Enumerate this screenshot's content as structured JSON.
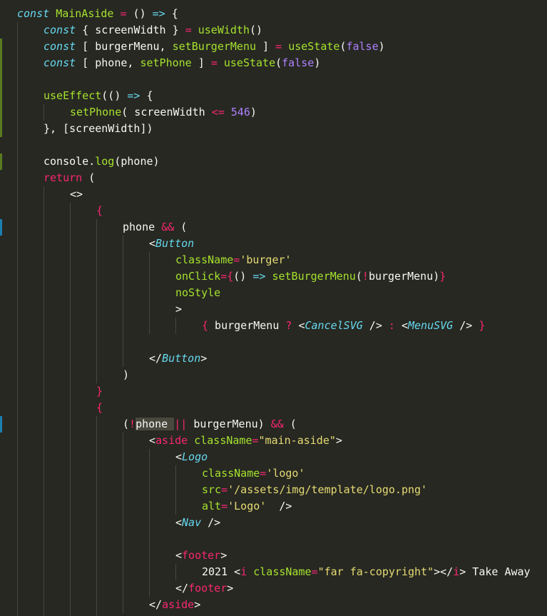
{
  "colors": {
    "background": "#272822",
    "keyword": "#66d9ef",
    "function": "#a6e22e",
    "operator": "#f92672",
    "string": "#e6db74",
    "number": "#ae81ff",
    "text": "#f8f8f2",
    "indent_guide": "#464741",
    "change_marker_added": "#5a7a1f",
    "change_marker_modified": "#1b7fb0"
  },
  "editor": {
    "lines": [
      {
        "indent": 0,
        "tokens": [
          {
            "t": "kw",
            "v": "const"
          },
          {
            "t": "pun",
            "v": " "
          },
          {
            "t": "fn",
            "v": "MainAside"
          },
          {
            "t": "pun",
            "v": " "
          },
          {
            "t": "op",
            "v": "="
          },
          {
            "t": "pun",
            "v": " () "
          },
          {
            "t": "kw",
            "v": "=>"
          },
          {
            "t": "pun",
            "v": " {"
          }
        ]
      },
      {
        "indent": 1,
        "tokens": [
          {
            "t": "kw",
            "v": "const"
          },
          {
            "t": "pun",
            "v": " { screenWidth } "
          },
          {
            "t": "op",
            "v": "="
          },
          {
            "t": "pun",
            "v": " "
          },
          {
            "t": "fn",
            "v": "useWidth"
          },
          {
            "t": "pun",
            "v": "()"
          }
        ]
      },
      {
        "indent": 1,
        "tokens": [
          {
            "t": "kw",
            "v": "const"
          },
          {
            "t": "pun",
            "v": " [ burgerMenu, "
          },
          {
            "t": "fn",
            "v": "setBurgerMenu"
          },
          {
            "t": "pun",
            "v": " ] "
          },
          {
            "t": "op",
            "v": "="
          },
          {
            "t": "pun",
            "v": " "
          },
          {
            "t": "fn",
            "v": "useState"
          },
          {
            "t": "pun",
            "v": "("
          },
          {
            "t": "bool",
            "v": "false"
          },
          {
            "t": "pun",
            "v": ")"
          }
        ],
        "marker": "added"
      },
      {
        "indent": 1,
        "tokens": [
          {
            "t": "kw",
            "v": "const"
          },
          {
            "t": "pun",
            "v": " [ phone, "
          },
          {
            "t": "fn",
            "v": "setPhone"
          },
          {
            "t": "pun",
            "v": " ] "
          },
          {
            "t": "op",
            "v": "="
          },
          {
            "t": "pun",
            "v": " "
          },
          {
            "t": "fn",
            "v": "useState"
          },
          {
            "t": "pun",
            "v": "("
          },
          {
            "t": "bool",
            "v": "false"
          },
          {
            "t": "pun",
            "v": ")"
          }
        ],
        "marker": "added"
      },
      {
        "indent": 0,
        "tokens": [],
        "marker": "added"
      },
      {
        "indent": 1,
        "tokens": [
          {
            "t": "fn",
            "v": "useEffect"
          },
          {
            "t": "pun",
            "v": "(() "
          },
          {
            "t": "kw",
            "v": "=>"
          },
          {
            "t": "pun",
            "v": " {"
          }
        ],
        "marker": "added"
      },
      {
        "indent": 2,
        "tokens": [
          {
            "t": "fn",
            "v": "setPhone"
          },
          {
            "t": "pun",
            "v": "( screenWidth "
          },
          {
            "t": "op",
            "v": "<="
          },
          {
            "t": "pun",
            "v": " "
          },
          {
            "t": "num",
            "v": "546"
          },
          {
            "t": "pun",
            "v": ")"
          }
        ],
        "marker": "added"
      },
      {
        "indent": 1,
        "tokens": [
          {
            "t": "pun",
            "v": "}, [screenWidth])"
          }
        ],
        "marker": "added"
      },
      {
        "indent": 0,
        "tokens": []
      },
      {
        "indent": 1,
        "tokens": [
          {
            "t": "id",
            "v": "console"
          },
          {
            "t": "pun",
            "v": "."
          },
          {
            "t": "fn",
            "v": "log"
          },
          {
            "t": "pun",
            "v": "(phone)"
          }
        ],
        "marker": "added"
      },
      {
        "indent": 1,
        "tokens": [
          {
            "t": "op",
            "v": "return"
          },
          {
            "t": "pun",
            "v": " ("
          }
        ]
      },
      {
        "indent": 2,
        "tokens": [
          {
            "t": "pun",
            "v": "<>"
          }
        ]
      },
      {
        "indent": 3,
        "tokens": [
          {
            "t": "brace",
            "v": "{"
          }
        ]
      },
      {
        "indent": 4,
        "tokens": [
          {
            "t": "id",
            "v": "phone "
          },
          {
            "t": "op",
            "v": "&&"
          },
          {
            "t": "pun",
            "v": " ("
          }
        ],
        "marker": "modified"
      },
      {
        "indent": 5,
        "tokens": [
          {
            "t": "pun",
            "v": "<"
          },
          {
            "t": "comp",
            "v": "Button"
          }
        ]
      },
      {
        "indent": 6,
        "tokens": [
          {
            "t": "attr",
            "v": "className"
          },
          {
            "t": "op",
            "v": "="
          },
          {
            "t": "str",
            "v": "'burger'"
          }
        ]
      },
      {
        "indent": 6,
        "tokens": [
          {
            "t": "attr",
            "v": "onClick"
          },
          {
            "t": "op",
            "v": "="
          },
          {
            "t": "brace",
            "v": "{"
          },
          {
            "t": "pun",
            "v": "() "
          },
          {
            "t": "kw",
            "v": "=>"
          },
          {
            "t": "pun",
            "v": " "
          },
          {
            "t": "fn",
            "v": "setBurgerMenu"
          },
          {
            "t": "pun",
            "v": "("
          },
          {
            "t": "op",
            "v": "!"
          },
          {
            "t": "pun",
            "v": "burgerMenu)"
          },
          {
            "t": "brace",
            "v": "}"
          }
        ]
      },
      {
        "indent": 6,
        "tokens": [
          {
            "t": "attr",
            "v": "noStyle"
          }
        ]
      },
      {
        "indent": 6,
        "tokens": [
          {
            "t": "pun",
            "v": ">"
          }
        ]
      },
      {
        "indent": 7,
        "tokens": [
          {
            "t": "brace",
            "v": "{"
          },
          {
            "t": "pun",
            "v": " burgerMenu "
          },
          {
            "t": "op",
            "v": "?"
          },
          {
            "t": "pun",
            "v": " <"
          },
          {
            "t": "comp",
            "v": "CancelSVG"
          },
          {
            "t": "pun",
            "v": " /> "
          },
          {
            "t": "op",
            "v": ":"
          },
          {
            "t": "pun",
            "v": " <"
          },
          {
            "t": "comp",
            "v": "MenuSVG"
          },
          {
            "t": "pun",
            "v": " /> "
          },
          {
            "t": "brace",
            "v": "}"
          }
        ]
      },
      {
        "indent": 0,
        "tokens": []
      },
      {
        "indent": 5,
        "tokens": [
          {
            "t": "pun",
            "v": "</"
          },
          {
            "t": "comp",
            "v": "Button"
          },
          {
            "t": "pun",
            "v": ">"
          }
        ]
      },
      {
        "indent": 4,
        "tokens": [
          {
            "t": "pun",
            "v": ")"
          }
        ]
      },
      {
        "indent": 3,
        "tokens": [
          {
            "t": "brace",
            "v": "}"
          }
        ]
      },
      {
        "indent": 3,
        "tokens": [
          {
            "t": "brace",
            "v": "{"
          }
        ]
      },
      {
        "indent": 4,
        "tokens": [
          {
            "t": "pun",
            "v": "("
          },
          {
            "t": "op",
            "v": "!"
          },
          {
            "t": "hl",
            "v": "phone "
          },
          {
            "t": "op",
            "v": "||"
          },
          {
            "t": "pun",
            "v": " burgerMenu) "
          },
          {
            "t": "op",
            "v": "&&"
          },
          {
            "t": "pun",
            "v": " ("
          }
        ],
        "marker": "modified"
      },
      {
        "indent": 5,
        "tokens": [
          {
            "t": "pun",
            "v": "<"
          },
          {
            "t": "tag",
            "v": "aside"
          },
          {
            "t": "pun",
            "v": " "
          },
          {
            "t": "attr",
            "v": "className"
          },
          {
            "t": "op",
            "v": "="
          },
          {
            "t": "str",
            "v": "\"main-aside\""
          },
          {
            "t": "pun",
            "v": ">"
          }
        ]
      },
      {
        "indent": 6,
        "tokens": [
          {
            "t": "pun",
            "v": "<"
          },
          {
            "t": "comp",
            "v": "Logo"
          }
        ]
      },
      {
        "indent": 7,
        "tokens": [
          {
            "t": "attr",
            "v": "className"
          },
          {
            "t": "op",
            "v": "="
          },
          {
            "t": "str",
            "v": "'logo'"
          }
        ]
      },
      {
        "indent": 7,
        "tokens": [
          {
            "t": "attr",
            "v": "src"
          },
          {
            "t": "op",
            "v": "="
          },
          {
            "t": "str",
            "v": "'/assets/img/template/logo.png'"
          }
        ]
      },
      {
        "indent": 7,
        "tokens": [
          {
            "t": "attr",
            "v": "alt"
          },
          {
            "t": "op",
            "v": "="
          },
          {
            "t": "str",
            "v": "'Logo'"
          },
          {
            "t": "pun",
            "v": "  />"
          }
        ]
      },
      {
        "indent": 6,
        "tokens": [
          {
            "t": "pun",
            "v": "<"
          },
          {
            "t": "comp",
            "v": "Nav"
          },
          {
            "t": "pun",
            "v": " />"
          }
        ]
      },
      {
        "indent": 0,
        "tokens": []
      },
      {
        "indent": 6,
        "tokens": [
          {
            "t": "pun",
            "v": "<"
          },
          {
            "t": "tag",
            "v": "footer"
          },
          {
            "t": "pun",
            "v": ">"
          }
        ]
      },
      {
        "indent": 7,
        "tokens": [
          {
            "t": "text",
            "v": "2021 "
          },
          {
            "t": "pun",
            "v": "<"
          },
          {
            "t": "tag",
            "v": "i"
          },
          {
            "t": "pun",
            "v": " "
          },
          {
            "t": "attr",
            "v": "className"
          },
          {
            "t": "op",
            "v": "="
          },
          {
            "t": "str",
            "v": "\"far fa-copyright\""
          },
          {
            "t": "pun",
            "v": "></"
          },
          {
            "t": "tag",
            "v": "i"
          },
          {
            "t": "pun",
            "v": ">"
          },
          {
            "t": "text",
            "v": " Take Away"
          }
        ]
      },
      {
        "indent": 6,
        "tokens": [
          {
            "t": "pun",
            "v": "</"
          },
          {
            "t": "tag",
            "v": "footer"
          },
          {
            "t": "pun",
            "v": ">"
          }
        ]
      },
      {
        "indent": 5,
        "tokens": [
          {
            "t": "pun",
            "v": "</"
          },
          {
            "t": "tag",
            "v": "aside"
          },
          {
            "t": "pun",
            "v": ">"
          }
        ]
      },
      {
        "indent": 4,
        "tokens": [
          {
            "t": "pun",
            "v": ")"
          }
        ]
      }
    ]
  }
}
